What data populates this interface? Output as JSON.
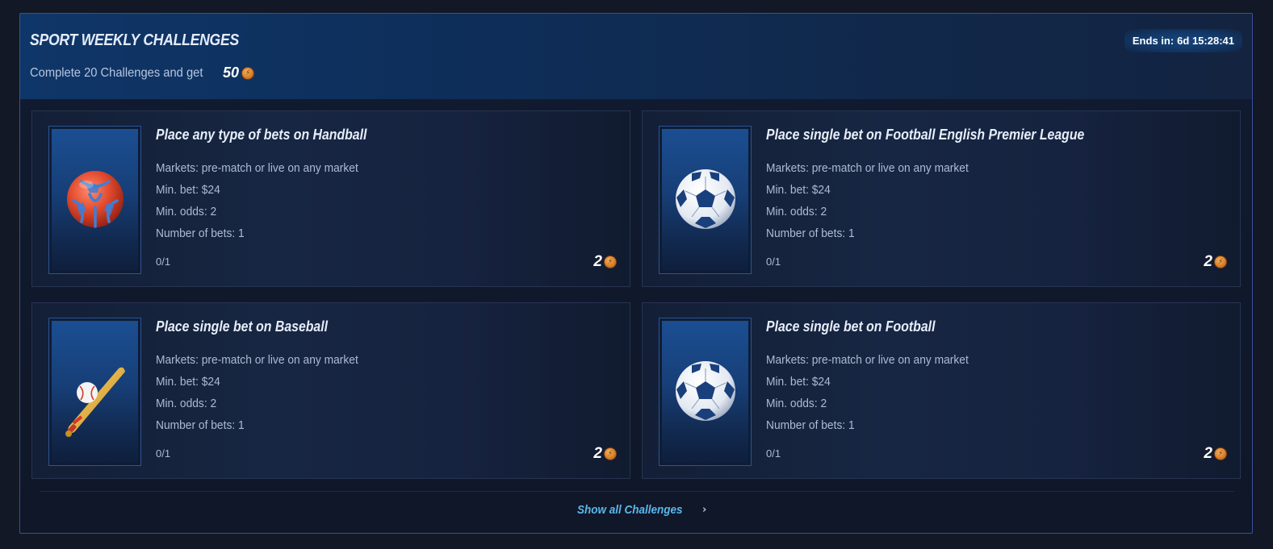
{
  "header": {
    "title": "SPORT WEEKLY CHALLENGES",
    "subtitle": "Complete 20 Challenges and get",
    "reward_amount": "50",
    "reward_icon": "coin-icon",
    "ends_label": "Ends in:",
    "ends_value": "6d 15:28:41"
  },
  "challenges": [
    {
      "title": "Place any type of bets on Handball",
      "icon": "handball-icon",
      "markets": "Markets:  pre-match or live on any market",
      "min_bet": "Min. bet: $24",
      "min_odds": "Min. odds: 2",
      "num_bets": "Number of bets: 1",
      "progress": "0/1",
      "reward": "2"
    },
    {
      "title": "Place single bet on Football English Premier League",
      "icon": "football-icon",
      "markets": "Markets:  pre-match or live on any market",
      "min_bet": "Min. bet: $24",
      "min_odds": "Min. odds: 2",
      "num_bets": "Number of bets: 1",
      "progress": "0/1",
      "reward": "2"
    },
    {
      "title": "Place single bet on Baseball",
      "icon": "baseball-icon",
      "markets": "Markets:  pre-match or live on any market",
      "min_bet": "Min. bet: $24",
      "min_odds": "Min. odds: 2",
      "num_bets": "Number of bets: 1",
      "progress": "0/1",
      "reward": "2"
    },
    {
      "title": "Place single bet on Football",
      "icon": "football-icon",
      "markets": "Markets:  pre-match or live on any market",
      "min_bet": "Min. bet: $24",
      "min_odds": "Min. odds: 2",
      "num_bets": "Number of bets: 1",
      "progress": "0/1",
      "reward": "2"
    }
  ],
  "footer": {
    "show_all_label": "Show all Challenges"
  },
  "colors": {
    "accent_link": "#5ab7ec",
    "panel_border": "#3b4f97",
    "coin": "#d9802c"
  }
}
